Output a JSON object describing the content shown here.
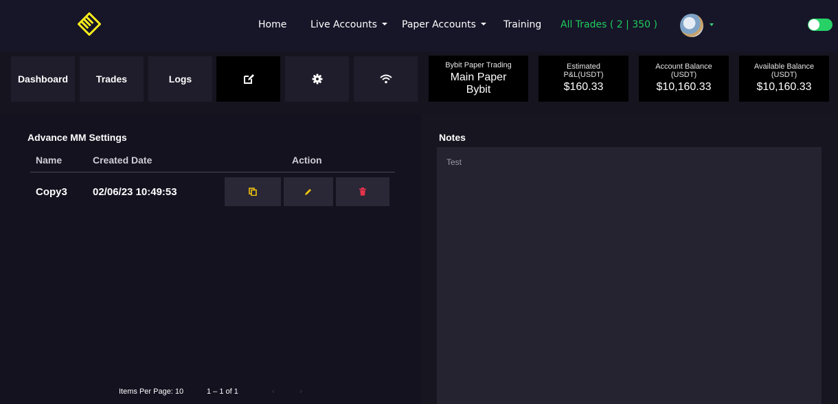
{
  "nav": {
    "home": "Home",
    "live_accounts": "Live Accounts",
    "paper_accounts": "Paper Accounts",
    "training": "Training",
    "all_trades": "All Trades ( 2 | 350 )"
  },
  "tabs": {
    "dashboard": "Dashboard",
    "trades": "Trades",
    "logs": "Logs"
  },
  "icons": {
    "edit": "edit-icon",
    "settings": "gear-icon",
    "wifi": "wifi-icon",
    "copy": "copy-icon",
    "pencil": "pencil-icon",
    "delete": "trash-icon"
  },
  "stats": {
    "account": {
      "label": "Bybit Paper Trading",
      "line1": "Main Paper",
      "line2": "Bybit"
    },
    "pnl": {
      "label1": "Estimated",
      "label2": "P&L(USDT)",
      "value": "$160.33"
    },
    "account_balance": {
      "label1": "Account Balance",
      "label2": "(USDT)",
      "value": "$10,160.33"
    },
    "available_balance": {
      "label1": "Available Balance",
      "label2": "(USDT)",
      "value": "$10,160.33"
    }
  },
  "settings_panel": {
    "title": "Advance MM Settings",
    "columns": [
      "Name",
      "Created Date",
      "Action"
    ],
    "rows": [
      {
        "name": "Copy3",
        "created": "02/06/23 10:49:53"
      }
    ],
    "pagination": {
      "items_per_page_label": "Items Per Page: 10",
      "range": "1 – 1 of 1"
    }
  },
  "notes": {
    "title": "Notes",
    "text": "Test"
  },
  "colors": {
    "accent_green": "#1ecf5e",
    "action_yellow": "#f2c40f",
    "action_red": "#e5334b",
    "logo_yellow": "#f5ec1c"
  }
}
